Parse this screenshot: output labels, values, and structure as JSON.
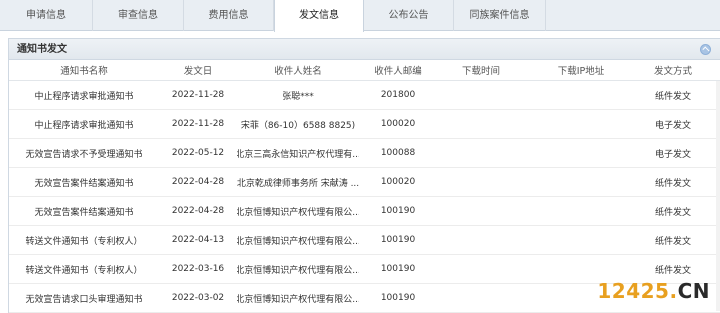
{
  "tabs": [
    {
      "label": "申请信息",
      "width": 93
    },
    {
      "label": "审查信息",
      "width": 91
    },
    {
      "label": "费用信息",
      "width": 90
    },
    {
      "label": "发文信息",
      "width": 90,
      "active": true
    },
    {
      "label": "公布公告",
      "width": 90
    },
    {
      "label": "同族案件信息",
      "width": 92
    }
  ],
  "panel": {
    "title": "通知书发文",
    "columns": [
      "通知书名称",
      "发文日",
      "收件人姓名",
      "收件人邮编",
      "下载时间",
      "下载IP地址",
      "发文方式"
    ],
    "rows": [
      [
        "中止程序请求审批通知书",
        "2022-11-28",
        "张聪***",
        "201800",
        "",
        "",
        "纸件发文"
      ],
      [
        "中止程序请求审批通知书",
        "2022-11-28",
        "宋菲（86-10）6588 8825)",
        "100020",
        "",
        "",
        "电子发文"
      ],
      [
        "无效宣告请求不予受理通知书",
        "2022-05-12",
        "北京三高永信知识产权代理有...",
        "100088",
        "",
        "",
        "电子发文"
      ],
      [
        "无效宣告案件结案通知书",
        "2022-04-28",
        "北京乾成律师事务所 宋献涛 ...",
        "100020",
        "",
        "",
        "纸件发文"
      ],
      [
        "无效宣告案件结案通知书",
        "2022-04-28",
        "北京恒博知识产权代理有限公...",
        "100190",
        "",
        "",
        "纸件发文"
      ],
      [
        "转送文件通知书（专利权人）",
        "2022-04-13",
        "北京恒博知识产权代理有限公...",
        "100190",
        "",
        "",
        "纸件发文"
      ],
      [
        "转送文件通知书（专利权人）",
        "2022-03-16",
        "北京恒博知识产权代理有限公...",
        "100190",
        "",
        "",
        "纸件发文"
      ],
      [
        "无效宣告请求口头审理通知书",
        "2022-03-02",
        "北京恒博知识产权代理有限公...",
        "100190",
        "",
        "",
        ""
      ]
    ]
  },
  "watermark": {
    "num": "12425",
    "dot": ".",
    "cn": "CN"
  }
}
